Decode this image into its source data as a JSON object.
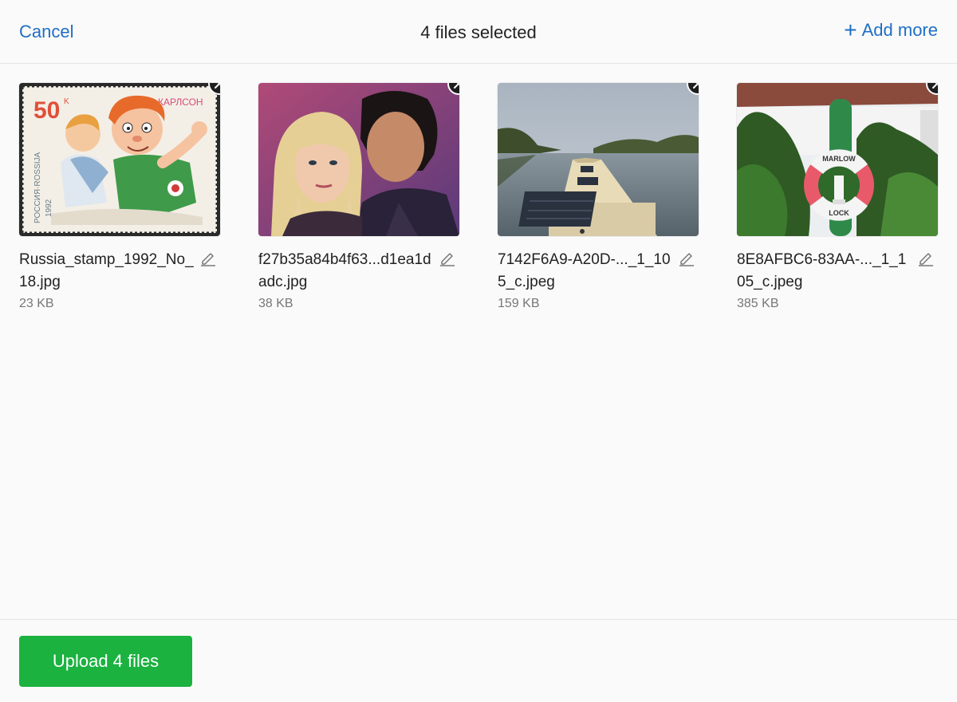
{
  "header": {
    "cancel_label": "Cancel",
    "title": "4 files selected",
    "add_more_label": "Add more"
  },
  "files": [
    {
      "name": "Russia_stamp_1992_No_18.jpg",
      "size": "23 KB",
      "preview": "stamp",
      "stamp_text": {
        "value": "50",
        "sup": "K",
        "brand": "КАРЛСОН",
        "country": "РОССИЯ·ROSSIJA",
        "year": "1992"
      }
    },
    {
      "name": "f27b35a84b4f63...d1ea1dadc.jpg",
      "size": "38 KB",
      "preview": "portrait"
    },
    {
      "name": "7142F6A9-A20D-..._1_105_c.jpeg",
      "size": "159 KB",
      "preview": "river"
    },
    {
      "name": "8E8AFBC6-83AA-..._1_105_c.jpeg",
      "size": "385 KB",
      "preview": "lifebuoy",
      "buoy_text": {
        "top": "MARLOW",
        "bottom": "LOCK"
      }
    }
  ],
  "footer": {
    "upload_label": "Upload 4 files"
  },
  "colors": {
    "link": "#1f6fc5",
    "upload_button": "#1bb240"
  }
}
